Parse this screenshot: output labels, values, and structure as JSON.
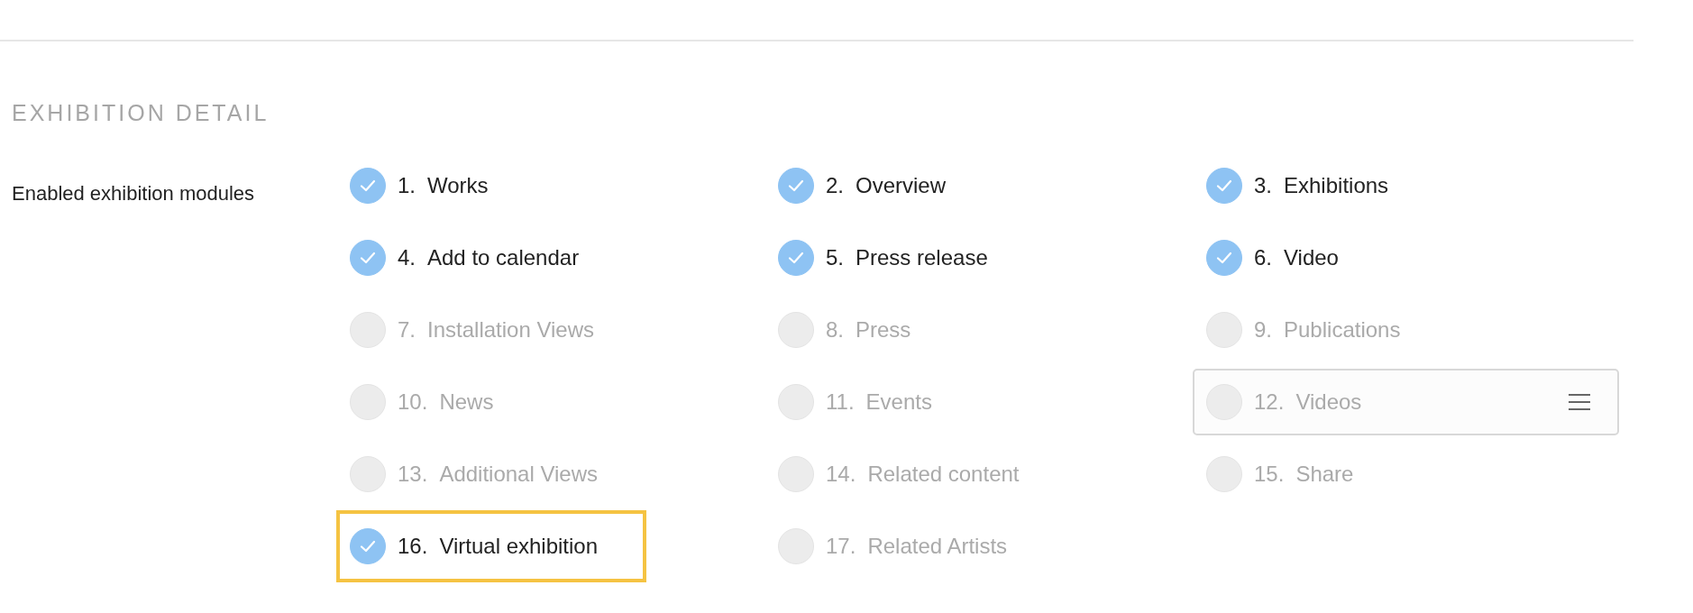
{
  "section": {
    "title": "EXHIBITION DETAIL"
  },
  "field_label": "Enabled exhibition modules",
  "modules": [
    {
      "number": "1.",
      "label": "Works",
      "checked": true,
      "hovered": false,
      "highlighted": false
    },
    {
      "number": "2.",
      "label": "Overview",
      "checked": true,
      "hovered": false,
      "highlighted": false
    },
    {
      "number": "3.",
      "label": "Exhibitions",
      "checked": true,
      "hovered": false,
      "highlighted": false
    },
    {
      "number": "4.",
      "label": "Add to calendar",
      "checked": true,
      "hovered": false,
      "highlighted": false
    },
    {
      "number": "5.",
      "label": "Press release",
      "checked": true,
      "hovered": false,
      "highlighted": false
    },
    {
      "number": "6.",
      "label": "Video",
      "checked": true,
      "hovered": false,
      "highlighted": false
    },
    {
      "number": "7.",
      "label": "Installation Views",
      "checked": false,
      "hovered": false,
      "highlighted": false
    },
    {
      "number": "8.",
      "label": "Press",
      "checked": false,
      "hovered": false,
      "highlighted": false
    },
    {
      "number": "9.",
      "label": "Publications",
      "checked": false,
      "hovered": false,
      "highlighted": false
    },
    {
      "number": "10.",
      "label": "News",
      "checked": false,
      "hovered": false,
      "highlighted": false
    },
    {
      "number": "11.",
      "label": "Events",
      "checked": false,
      "hovered": false,
      "highlighted": false
    },
    {
      "number": "12.",
      "label": "Videos",
      "checked": false,
      "hovered": true,
      "highlighted": false
    },
    {
      "number": "13.",
      "label": "Additional Views",
      "checked": false,
      "hovered": false,
      "highlighted": false
    },
    {
      "number": "14.",
      "label": "Related content",
      "checked": false,
      "hovered": false,
      "highlighted": false
    },
    {
      "number": "15.",
      "label": "Share",
      "checked": false,
      "hovered": false,
      "highlighted": false
    },
    {
      "number": "16.",
      "label": "Virtual exhibition",
      "checked": true,
      "hovered": false,
      "highlighted": true
    },
    {
      "number": "17.",
      "label": "Related Artists",
      "checked": false,
      "hovered": false,
      "highlighted": false
    }
  ]
}
